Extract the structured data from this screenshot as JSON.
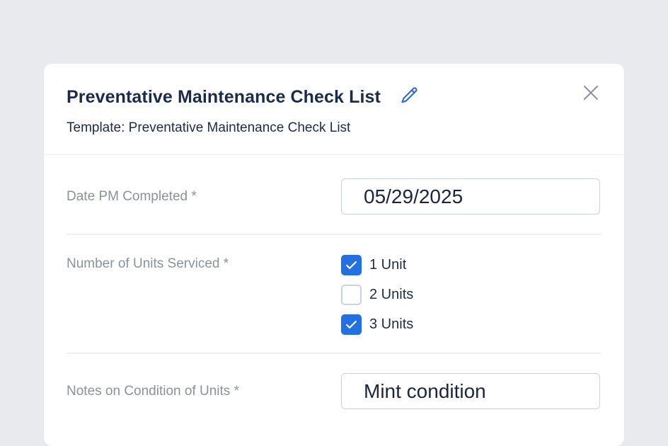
{
  "modal": {
    "title": "Preventative Maintenance Check List",
    "subtitle": "Template: Preventative Maintenance Check List",
    "edit_icon": "pencil-icon",
    "close_icon": "close-icon"
  },
  "fields": {
    "date_completed": {
      "label": "Date PM Completed *",
      "value": "05/29/2025"
    },
    "units_serviced": {
      "label": "Number of Units Serviced *",
      "options": [
        {
          "label": "1 Unit",
          "checked": true
        },
        {
          "label": "2 Units",
          "checked": false
        },
        {
          "label": "3 Units",
          "checked": true
        }
      ]
    },
    "notes": {
      "label": "Notes on Condition of Units *",
      "value": "Mint condition"
    }
  },
  "colors": {
    "accent": "#2470e0",
    "title": "#1c2b4a",
    "label": "#8c919b",
    "background": "#e9eaed"
  }
}
